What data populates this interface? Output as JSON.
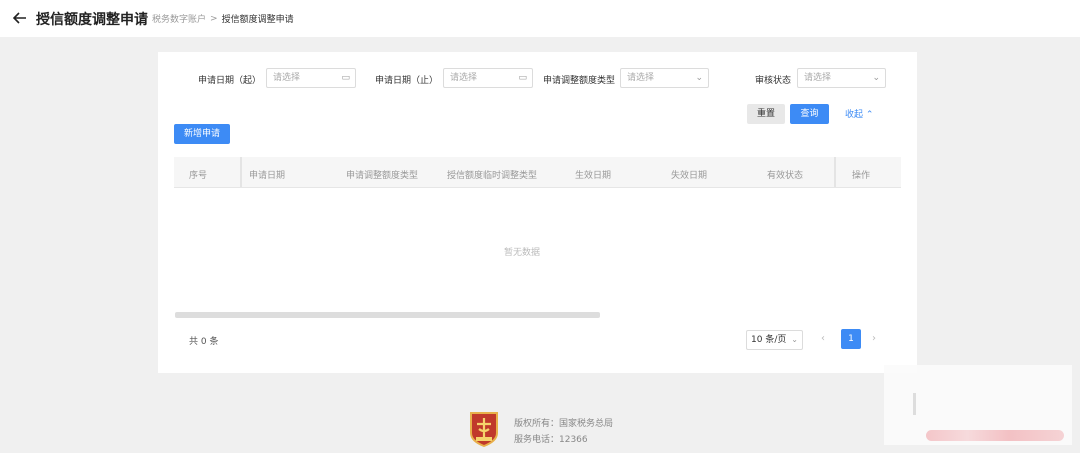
{
  "header": {
    "back_icon": "arrow-left-icon",
    "title": "授信额度调整申请",
    "breadcrumb": [
      "税务数字账户",
      ">",
      "授信额度调整申请"
    ]
  },
  "filters": {
    "start_date_label": "申请日期（起）",
    "start_date_placeholder": "请选择",
    "end_date_label": "申请日期（止）",
    "end_date_placeholder": "请选择",
    "type_label": "申请调整额度类型",
    "type_placeholder": "请选择",
    "status_label": "审核状态",
    "status_placeholder": "请选择",
    "reset_label": "重置",
    "query_label": "查询",
    "collapse_label": "收起"
  },
  "toolbar": {
    "add_label": "新增申请"
  },
  "table": {
    "columns": [
      "序号",
      "申请日期",
      "申请调整额度类型",
      "授信额度临时调整类型",
      "生效日期",
      "失效日期",
      "有效状态",
      "操作"
    ],
    "rows": [],
    "empty_text": "暂无数据"
  },
  "pagination": {
    "total_text": "共 0 条",
    "page_size": "10 条/页",
    "current_page": "1"
  },
  "footer": {
    "copyright": "版权所有：国家税务总局",
    "phone": "服务电话：12366"
  },
  "colors": {
    "primary": "#3d8bf5",
    "background": "#f0f0f0"
  }
}
